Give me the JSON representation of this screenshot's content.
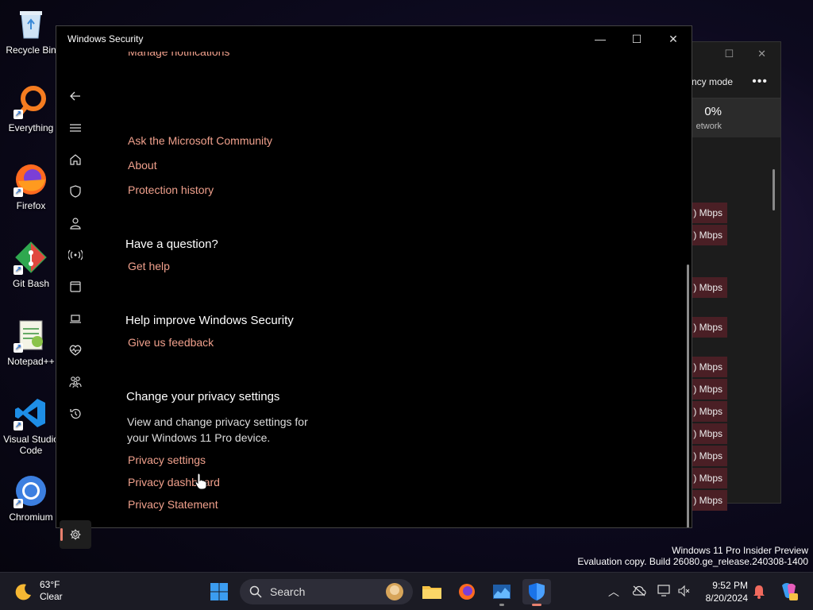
{
  "desktop": {
    "icons": [
      {
        "label": "Recycle Bin",
        "icon": "recycle-bin-icon"
      },
      {
        "label": "Everything",
        "icon": "everything-search-icon"
      },
      {
        "label": "Firefox",
        "icon": "firefox-icon"
      },
      {
        "label": "Git Bash",
        "icon": "git-bash-icon"
      },
      {
        "label": "Notepad++",
        "icon": "notepad-plus-plus-icon"
      },
      {
        "label": "Visual Studio Code",
        "icon": "vscode-icon"
      },
      {
        "label": "Chromium",
        "icon": "chromium-icon"
      }
    ]
  },
  "background_window": {
    "toolbar_label": "ncy mode",
    "network_pct": "0%",
    "network_label": "etwork",
    "rows": [
      ") Mbps",
      ") Mbps",
      ") Mbps",
      ") Mbps",
      ") Mbps",
      ") Mbps",
      ") Mbps",
      ") Mbps",
      ") Mbps",
      ") Mbps",
      ") Mbps"
    ]
  },
  "window": {
    "title": "Windows Security",
    "controls": {
      "minimize": "—",
      "maximize": "☐",
      "close": "✕"
    }
  },
  "content": {
    "partial_link": "Manage notifications",
    "links_top": [
      "Ask the Microsoft Community",
      "About",
      "Protection history"
    ],
    "question_heading": "Have a question?",
    "get_help": "Get help",
    "improve_heading": "Help improve Windows Security",
    "feedback": "Give us feedback",
    "privacy_heading": "Change your privacy settings",
    "privacy_text": "View and change privacy settings for your Windows 11 Pro device.",
    "privacy_links": [
      "Privacy settings",
      "Privacy dashboard",
      "Privacy Statement"
    ]
  },
  "watermark": {
    "line1": "Windows 11 Pro Insider Preview",
    "line2": "Evaluation copy. Build 26080.ge_release.240308-1400"
  },
  "taskbar": {
    "weather_temp": "63°F",
    "weather_cond": "Clear",
    "search_placeholder": "Search",
    "time": "9:52 PM",
    "date": "8/20/2024"
  },
  "colors": {
    "accent": "#f0a08c",
    "window_bg": "#000000",
    "taskbar_bg": "#1b1b24"
  }
}
